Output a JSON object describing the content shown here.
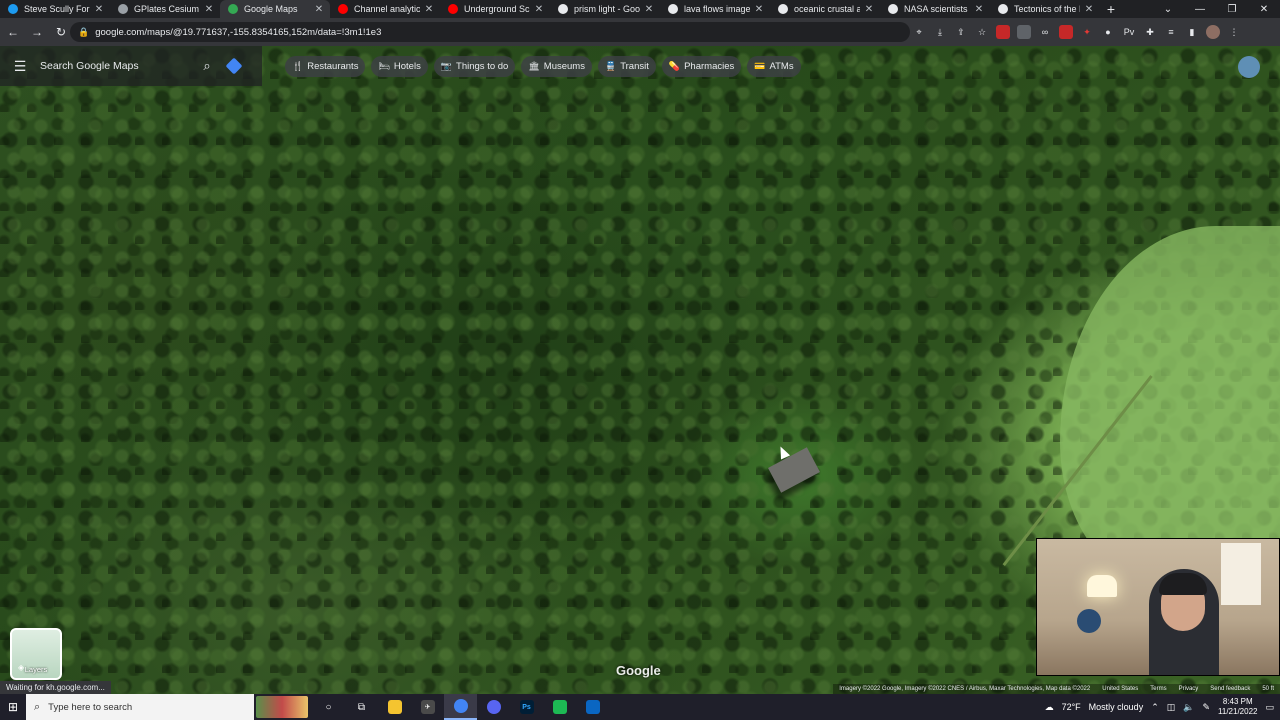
{
  "browser": {
    "tabs": [
      {
        "label": "Steve Scully For US",
        "favicon_color": "#1d9bf0",
        "active": false
      },
      {
        "label": "GPlates Cesium",
        "favicon_color": "#9aa0a6",
        "active": false
      },
      {
        "label": "Google Maps",
        "favicon_color": "#34a853",
        "active": true
      },
      {
        "label": "Channel analytics",
        "favicon_color": "#ff0000",
        "active": false
      },
      {
        "label": "Underground Scie",
        "favicon_color": "#ff0000",
        "active": false
      },
      {
        "label": "prism light - Goog",
        "favicon_color": "#e8eaed",
        "active": false
      },
      {
        "label": "lava flows images",
        "favicon_color": "#e8eaed",
        "active": false
      },
      {
        "label": "oceanic crustal ag",
        "favicon_color": "#e8eaed",
        "active": false
      },
      {
        "label": "NASA scientists sa",
        "favicon_color": "#e8eaed",
        "active": false
      },
      {
        "label": "Tectonics of the N",
        "favicon_color": "#e8eaed",
        "active": false
      }
    ],
    "url": "google.com/maps/@19.771637,-155.8354165,152m/data=!3m1!1e3"
  },
  "maps": {
    "search_placeholder": "Search Google Maps",
    "chips": [
      {
        "label": "Restaurants",
        "icon": "fork-knife-icon",
        "glyph": "🍴"
      },
      {
        "label": "Hotels",
        "icon": "bed-icon",
        "glyph": "🛏"
      },
      {
        "label": "Things to do",
        "icon": "camera-icon",
        "glyph": "📷"
      },
      {
        "label": "Museums",
        "icon": "museum-icon",
        "glyph": "🏛"
      },
      {
        "label": "Transit",
        "icon": "train-icon",
        "glyph": "🚆"
      },
      {
        "label": "Pharmacies",
        "icon": "pharmacy-icon",
        "glyph": "💊"
      },
      {
        "label": "ATMs",
        "icon": "atm-icon",
        "glyph": "💳"
      }
    ],
    "layers_label": "Layers",
    "logo_text": "Google",
    "attribution": {
      "imagery": "Imagery ©2022 Google, Imagery ©2022 CNES / Airbus, Maxar Technologies, Map data ©2022",
      "region": "United States",
      "terms": "Terms",
      "privacy": "Privacy",
      "feedback": "Send feedback",
      "scale": "50 ft"
    }
  },
  "status_text": "Waiting for kh.google.com...",
  "taskbar": {
    "search_placeholder": "Type here to search",
    "weather_temp": "72°F",
    "weather_text": "Mostly cloudy",
    "time": "8:43 PM",
    "date": "11/21/2022"
  },
  "colors": {
    "chrome_dark": "#202124",
    "chrome_toolbar": "#35363a",
    "accent_blue": "#4285f4"
  }
}
